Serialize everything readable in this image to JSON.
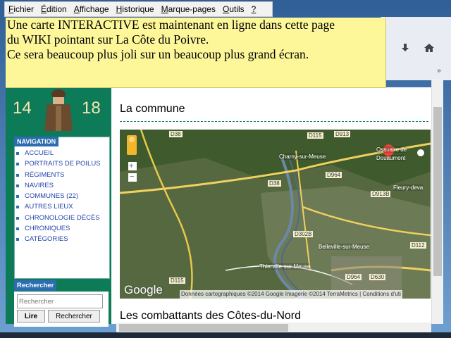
{
  "menu": [
    {
      "label": "Fichier",
      "u": "F",
      "rest": "ichier"
    },
    {
      "label": "Édition",
      "u": "É",
      "rest": "dition"
    },
    {
      "label": "Affichage",
      "u": "A",
      "rest": "ffichage"
    },
    {
      "label": "Historique",
      "u": "H",
      "rest": "istorique"
    },
    {
      "label": "Marque-pages",
      "u": "M",
      "rest": "arque-pages"
    },
    {
      "label": "Outils",
      "u": "O",
      "rest": "utils"
    },
    {
      "label": "?",
      "u": "?",
      "rest": ""
    }
  ],
  "note": {
    "line1": "Une carte INTERACTIVE est maintenant en ligne dans cette page",
    "line2": "du WIKI pointant sur La Côte du Poivre.",
    "line3": "Ce sera beaucoup plus joli sur un beaucoup plus grand écran."
  },
  "logo": {
    "left": "14",
    "right": "18"
  },
  "navigation": {
    "title": "NAVIGATION",
    "items": [
      "ACCUEIL",
      "PORTRAITS DE POILUS",
      "RÉGIMENTS",
      "NAVIRES",
      "COMMUNES (22)",
      "AUTRES LIEUX",
      "CHRONOLOGIE DÉCÈS",
      "CHRONIQUES",
      "CATÉGORIES"
    ]
  },
  "search": {
    "title": "Rechercher",
    "placeholder": "Rechercher",
    "go": "Lire",
    "search": "Rechercher"
  },
  "main": {
    "section1": "La commune",
    "section2": "Les combattants des Côtes-du-Nord"
  },
  "map": {
    "labels": [
      "D38",
      "D115",
      "D913",
      "Charny-sur-Meuse",
      "Ossuaire de",
      "Douaumont",
      "D964",
      "D38",
      "Fleury-deva",
      "D913B",
      "D302B",
      "D112",
      "Belleville-sur-Meuse",
      "Thierville-sur-Meuse",
      "D964",
      "D630",
      "D115"
    ],
    "google": "Google",
    "attribution": "Données cartographiques ©2014 Google Imagerie ©2014 TerraMetrics",
    "conditions": "Conditions d'uti"
  }
}
